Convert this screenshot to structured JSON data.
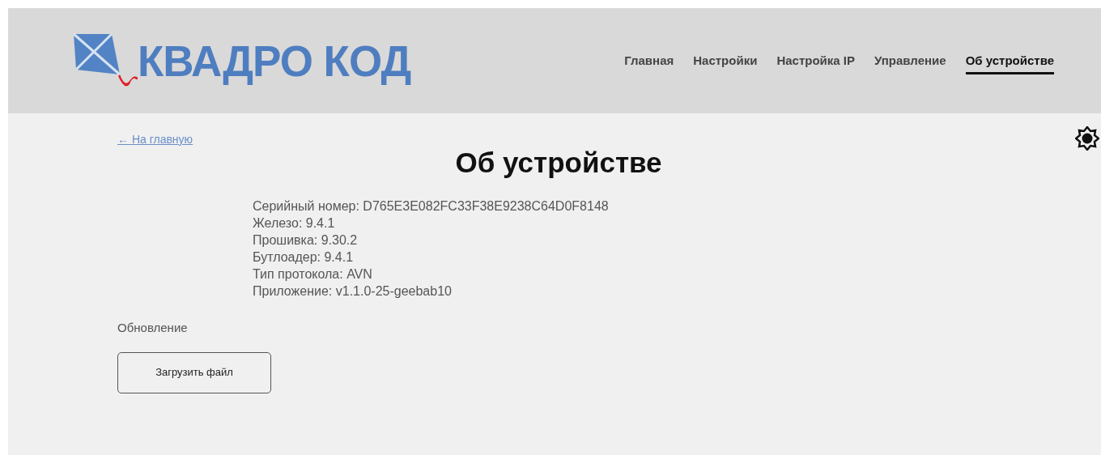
{
  "brand": {
    "name": "КВАДРО КОД"
  },
  "nav": [
    {
      "label": "Главная",
      "selected": false
    },
    {
      "label": "Настройки",
      "selected": false
    },
    {
      "label": "Настройка IP",
      "selected": false
    },
    {
      "label": "Управление",
      "selected": false
    },
    {
      "label": "Об устройстве",
      "selected": true
    }
  ],
  "back_link": "← На главную",
  "title": "Об устройстве",
  "info": [
    "Серийный номер: D765E3E082FC33F38E9238C64D0F8148",
    "Железо: 9.4.1",
    "Прошивка: 9.30.2",
    "Бутлоадер: 9.4.1",
    "Тип протокола: AVN",
    "Приложение: v1.1.0-25-geebab10"
  ],
  "update": {
    "label": "Обновление",
    "button": "Загрузить файл"
  }
}
